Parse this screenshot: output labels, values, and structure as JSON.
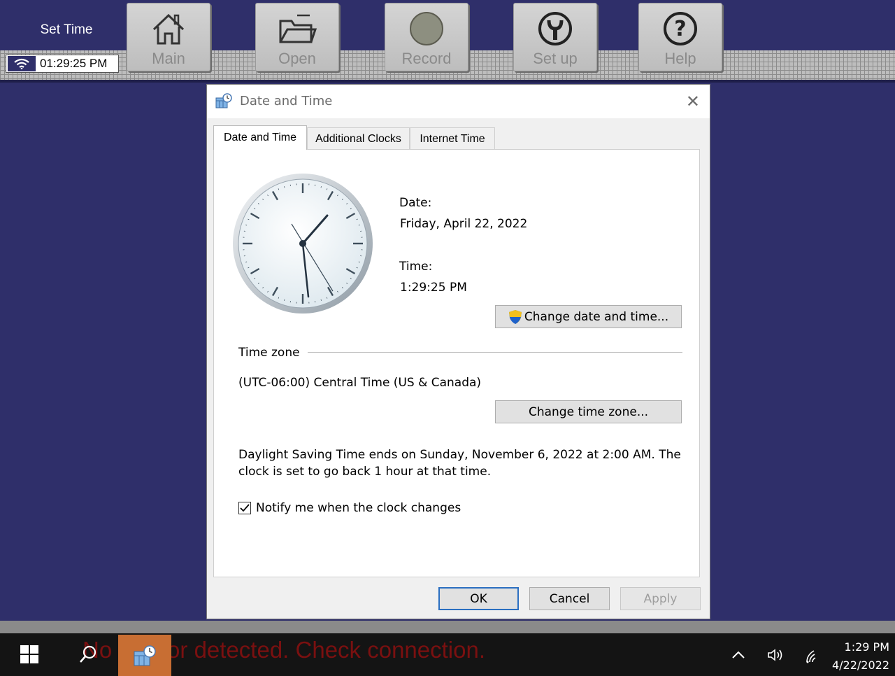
{
  "app": {
    "screen_title": "Set Time",
    "clock_time": "01:29:25 PM",
    "toolbar": {
      "main": "Main",
      "open": "Open",
      "record": "Record",
      "setup": "Set up",
      "help": "Help"
    }
  },
  "dialog": {
    "title": "Date and Time",
    "tabs": [
      "Date and Time",
      "Additional Clocks",
      "Internet Time"
    ],
    "date_label": "Date:",
    "date_value": "Friday, April 22, 2022",
    "time_label": "Time:",
    "time_value": "1:29:25 PM",
    "change_datetime_button": "Change date and time...",
    "timezone_group_label": "Time zone",
    "timezone_value": "(UTC-06:00) Central Time (US & Canada)",
    "change_timezone_button": "Change time zone...",
    "dst_line1": "Daylight Saving Time ends on Sunday, November 6, 2022 at 2:00 AM. The",
    "dst_line2": "clock is set to go back 1 hour at that time.",
    "notify_label": "Notify me when the clock changes",
    "notify_checked": true,
    "ok_button": "OK",
    "cancel_button": "Cancel",
    "apply_button": "Apply"
  },
  "status": {
    "message": "No sensor detected. Check connection."
  },
  "taskbar": {
    "time": "1:29 PM",
    "date": "4/22/2022"
  },
  "colors": {
    "background": "#2f2f6a",
    "status_text": "#7a1010",
    "pinned_app": "#c86e33",
    "default_button_border": "#2b6fc1"
  }
}
